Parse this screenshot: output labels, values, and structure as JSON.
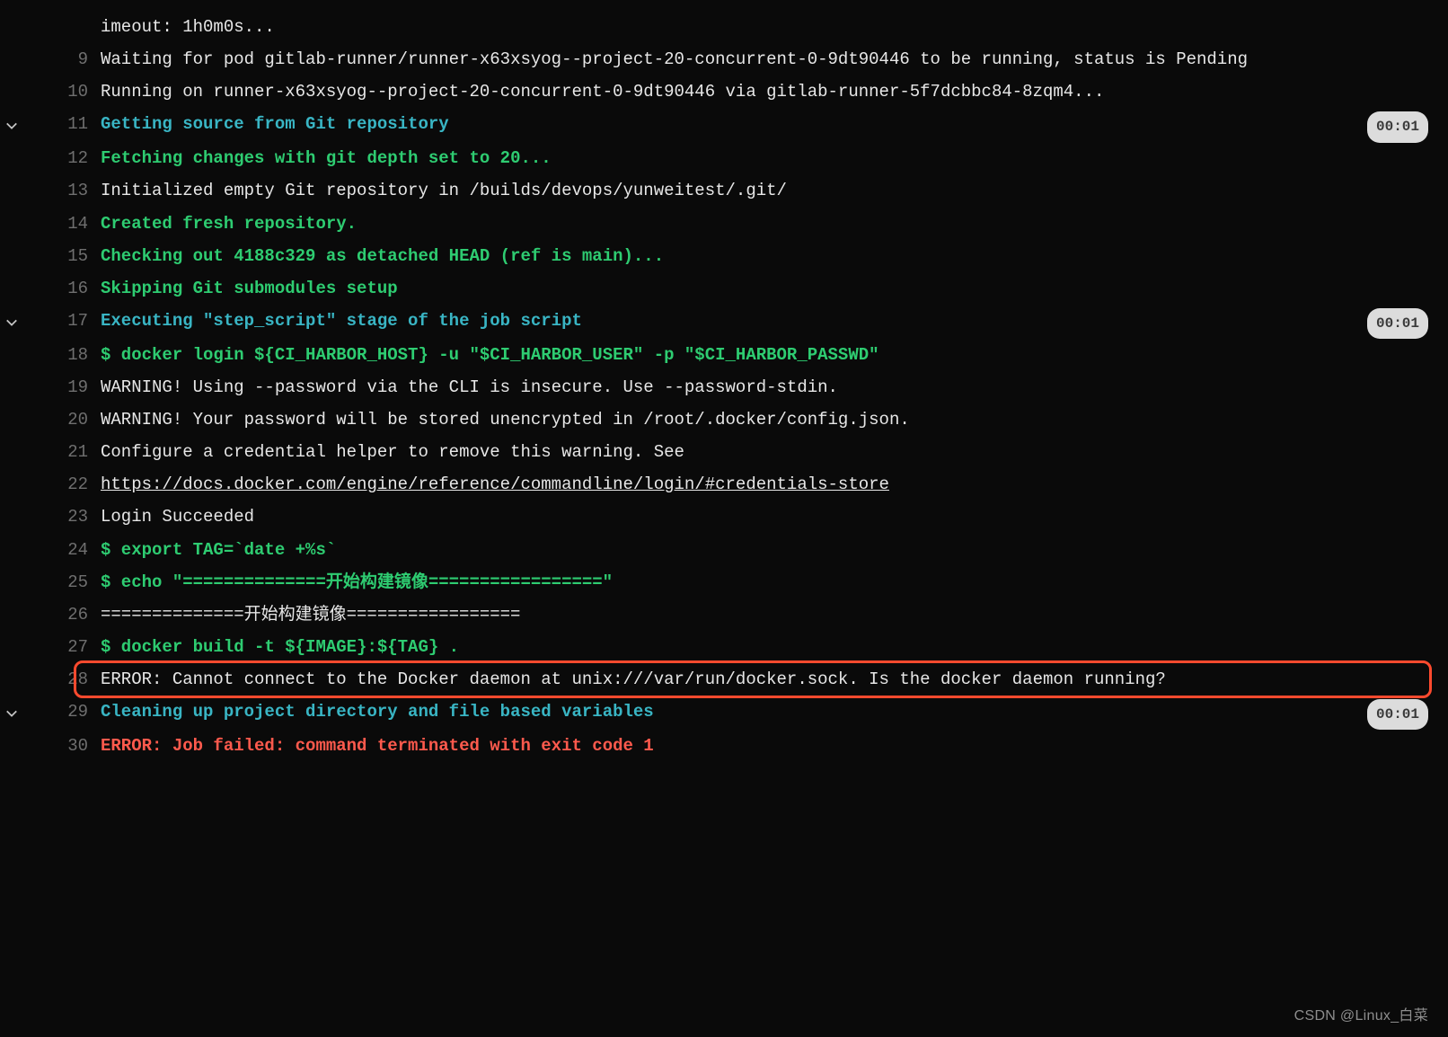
{
  "lines": [
    {
      "num": "",
      "caret": false,
      "cls": "c-white",
      "text": "imeout: 1h0m0s...",
      "badge": null
    },
    {
      "num": "9",
      "caret": false,
      "cls": "c-white",
      "text": "Waiting for pod gitlab-runner/runner-x63xsyog--project-20-concurrent-0-9dt90446 to be running, status is Pending",
      "badge": null
    },
    {
      "num": "10",
      "caret": false,
      "cls": "c-white",
      "text": "Running on runner-x63xsyog--project-20-concurrent-0-9dt90446 via gitlab-runner-5f7dcbbc84-8zqm4...",
      "badge": null
    },
    {
      "num": "11",
      "caret": true,
      "cls": "c-teal",
      "text": "Getting source from Git repository",
      "badge": "00:01"
    },
    {
      "num": "12",
      "caret": false,
      "cls": "c-green",
      "text": "Fetching changes with git depth set to 20...",
      "badge": null
    },
    {
      "num": "13",
      "caret": false,
      "cls": "c-white",
      "text": "Initialized empty Git repository in /builds/devops/yunweitest/.git/",
      "badge": null
    },
    {
      "num": "14",
      "caret": false,
      "cls": "c-green",
      "text": "Created fresh repository.",
      "badge": null
    },
    {
      "num": "15",
      "caret": false,
      "cls": "c-green",
      "text": "Checking out 4188c329 as detached HEAD (ref is main)...",
      "badge": null
    },
    {
      "num": "16",
      "caret": false,
      "cls": "c-green",
      "text": "Skipping Git submodules setup",
      "badge": null
    },
    {
      "num": "17",
      "caret": true,
      "cls": "c-teal",
      "text": "Executing \"step_script\" stage of the job script",
      "badge": "00:01"
    },
    {
      "num": "18",
      "caret": false,
      "cls": "c-green",
      "text": "$ docker login ${CI_HARBOR_HOST} -u \"$CI_HARBOR_USER\" -p \"$CI_HARBOR_PASSWD\"",
      "badge": null
    },
    {
      "num": "19",
      "caret": false,
      "cls": "c-white",
      "text": "WARNING! Using --password via the CLI is insecure. Use --password-stdin.",
      "badge": null
    },
    {
      "num": "20",
      "caret": false,
      "cls": "c-white",
      "text": "WARNING! Your password will be stored unencrypted in /root/.docker/config.json.",
      "badge": null
    },
    {
      "num": "21",
      "caret": false,
      "cls": "c-white",
      "text": "Configure a credential helper to remove this warning. See",
      "badge": null
    },
    {
      "num": "22",
      "caret": false,
      "cls": "c-link",
      "text": "https://docs.docker.com/engine/reference/commandline/login/#credentials-store",
      "badge": null
    },
    {
      "num": "23",
      "caret": false,
      "cls": "c-white",
      "text": "Login Succeeded",
      "badge": null
    },
    {
      "num": "24",
      "caret": false,
      "cls": "c-green",
      "text": "$ export TAG=`date +%s`",
      "badge": null
    },
    {
      "num": "25",
      "caret": false,
      "cls": "c-green",
      "text": "$ echo \"==============开始构建镜像=================\"",
      "badge": null
    },
    {
      "num": "26",
      "caret": false,
      "cls": "c-white",
      "text": "==============开始构建镜像=================",
      "badge": null
    },
    {
      "num": "27",
      "caret": false,
      "cls": "c-green",
      "text": "$ docker build -t ${IMAGE}:${TAG} .",
      "badge": null
    },
    {
      "num": "28",
      "caret": false,
      "cls": "c-white",
      "text": "ERROR: Cannot connect to the Docker daemon at unix:///var/run/docker.sock. Is the docker daemon running?",
      "badge": null,
      "highlight": true
    },
    {
      "num": "29",
      "caret": true,
      "cls": "c-teal",
      "text": "Cleaning up project directory and file based variables",
      "badge": "00:01"
    },
    {
      "num": "30",
      "caret": false,
      "cls": "c-red",
      "text": "ERROR: Job failed: command terminated with exit code 1",
      "badge": null
    }
  ],
  "watermark": "CSDN @Linux_白菜"
}
